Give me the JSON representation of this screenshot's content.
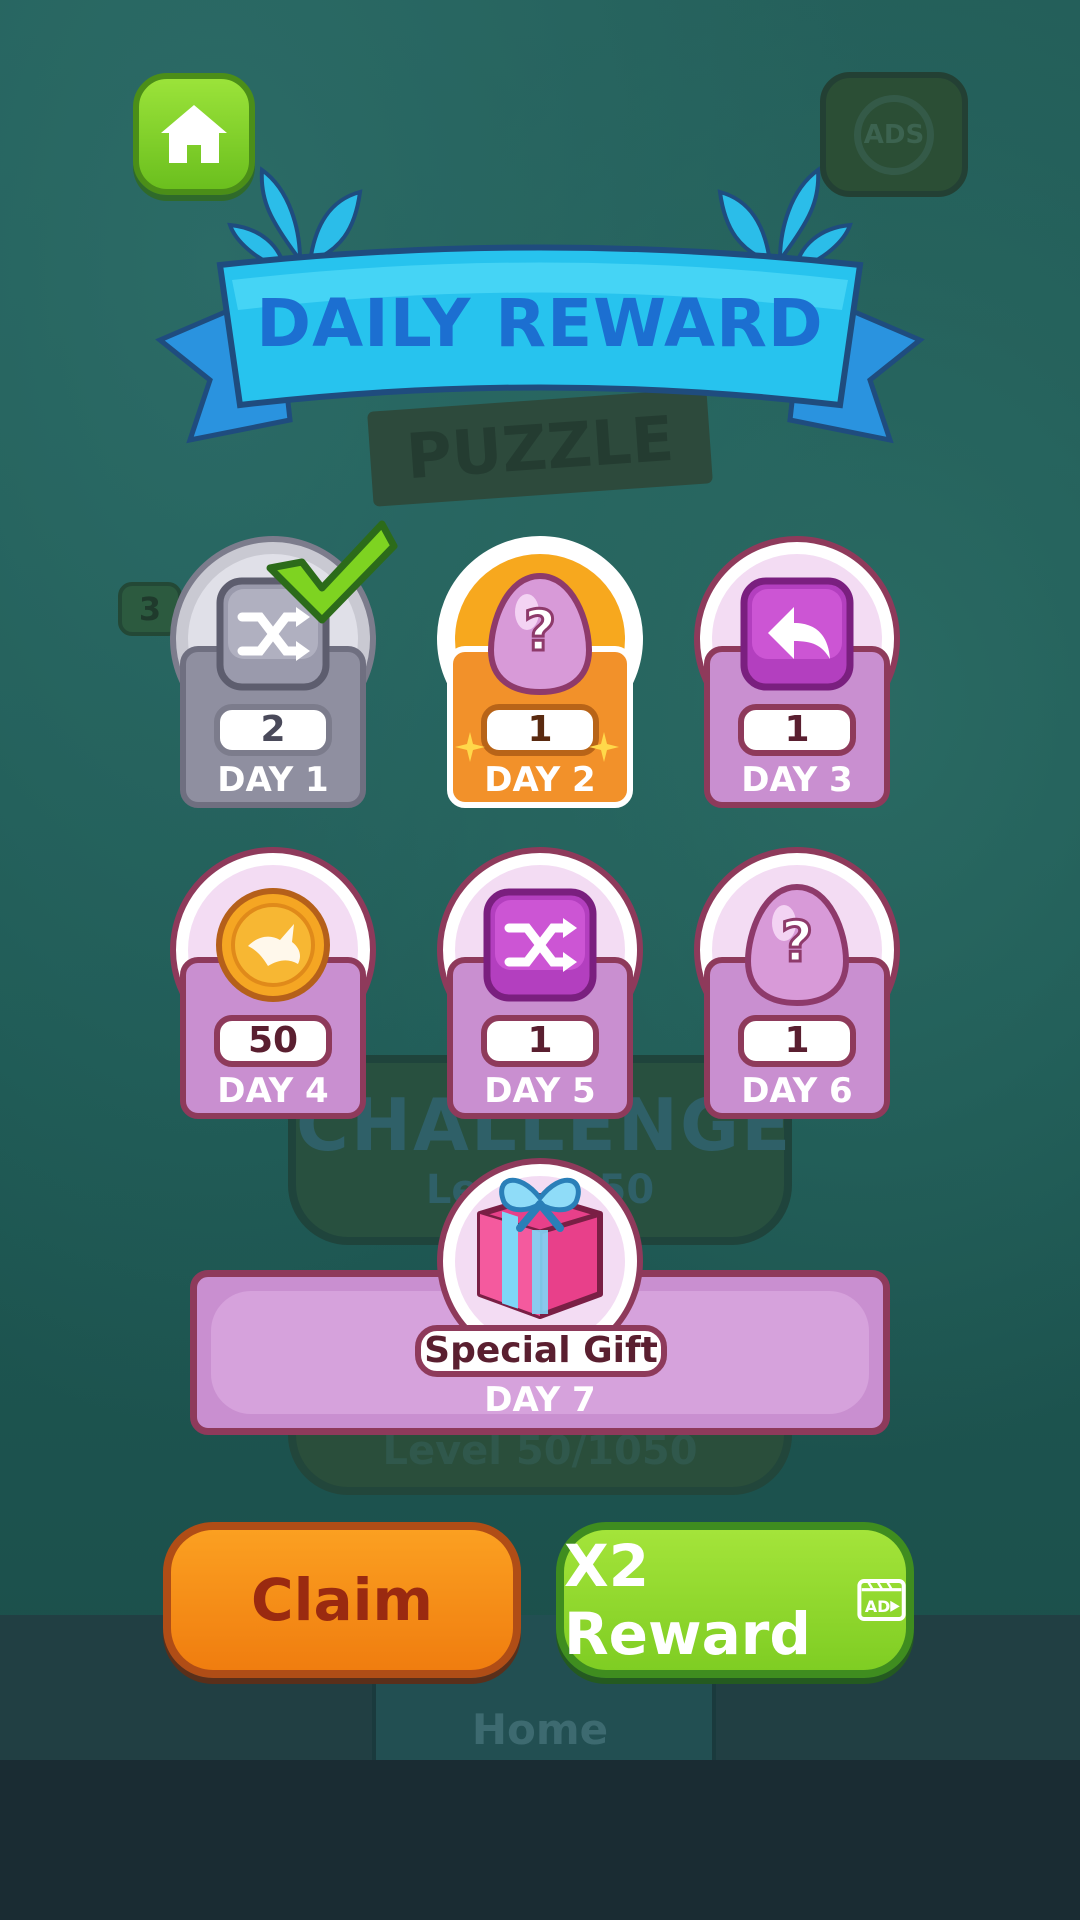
{
  "background": {
    "puzzle_sign": "PUZZLE",
    "ads_label": "ADS",
    "challenge_title": "CHALLENGE",
    "challenge_level": "Lev",
    "challenge_level_value": "50",
    "challenge2_level": "Level 50/1050",
    "nav_home": "Home",
    "side_badge": "3"
  },
  "banner": {
    "title": "DAILY REWARD"
  },
  "days": [
    {
      "label": "DAY 1",
      "count": "2",
      "reward": "shuffle",
      "state": "claimed"
    },
    {
      "label": "DAY 2",
      "count": "1",
      "reward": "mystery-egg",
      "state": "current"
    },
    {
      "label": "DAY 3",
      "count": "1",
      "reward": "undo",
      "state": "locked"
    },
    {
      "label": "DAY 4",
      "count": "50",
      "reward": "coin",
      "state": "locked"
    },
    {
      "label": "DAY 5",
      "count": "1",
      "reward": "shuffle",
      "state": "locked"
    },
    {
      "label": "DAY 6",
      "count": "1",
      "reward": "mystery-egg",
      "state": "locked"
    }
  ],
  "special": {
    "label": "DAY 7",
    "reward_text": "Special Gift",
    "reward": "gift-box"
  },
  "buttons": {
    "claim": "Claim",
    "x2_reward": "X2 Reward",
    "ad_icon_text": "AD"
  },
  "colors": {
    "claim_orange": "#f28a18",
    "reward_green": "#8ed42c",
    "banner_blue": "#23b9ea",
    "card_purple": "#c98fd0",
    "card_border": "#8e3a5b"
  }
}
